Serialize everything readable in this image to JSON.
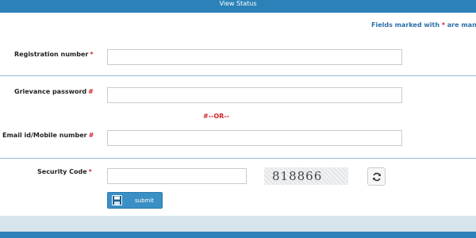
{
  "header": {
    "title": "View Status"
  },
  "note": {
    "prefix": "Fields marked with ",
    "star": "*",
    "suffix": " are man"
  },
  "form": {
    "registration": {
      "label": "Registration number",
      "required_marker": "*",
      "value": ""
    },
    "grievance_password": {
      "label": "Grievance password",
      "required_marker": "#",
      "value": ""
    },
    "or_text": "#--OR--",
    "email_mobile": {
      "label": "Email id/Mobile number",
      "required_marker": "#",
      "value": ""
    },
    "security_code": {
      "label": "Security Code",
      "required_marker": "*",
      "value": ""
    },
    "captcha": {
      "text": "818866"
    },
    "refresh_icon": "refresh-icon",
    "submit": {
      "label": "submit",
      "icon": "save-icon"
    }
  },
  "colors": {
    "header_bar": "#2c82b8",
    "required": "#d0242b",
    "note_text": "#2c6ea8",
    "submit_bg": "#3a8fc4"
  }
}
